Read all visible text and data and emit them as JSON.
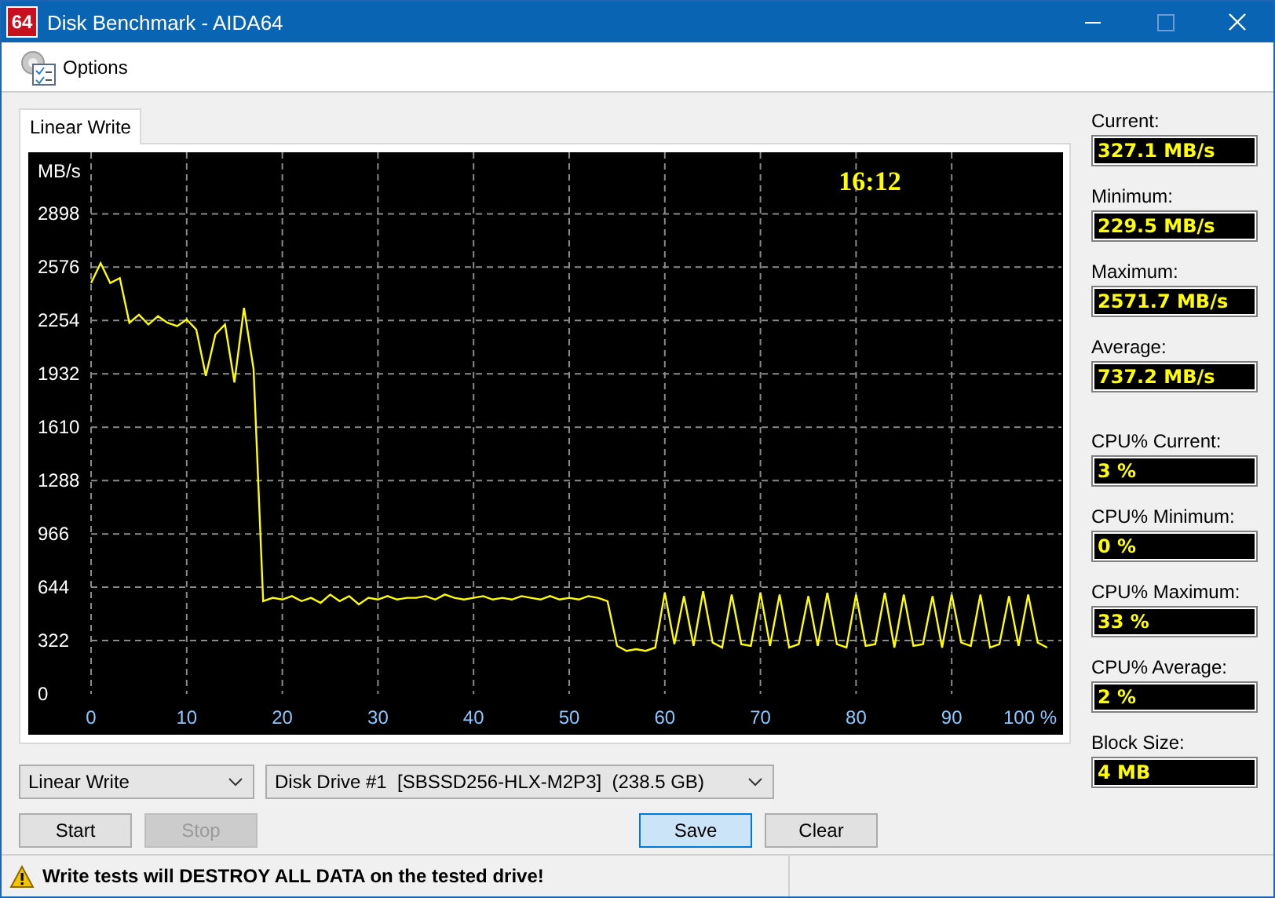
{
  "window": {
    "icon_label": "64",
    "title": "Disk Benchmark - AIDA64"
  },
  "menu": [
    {
      "label": "Options"
    }
  ],
  "tabs": [
    {
      "label": "Linear Write",
      "selected": true
    }
  ],
  "chart": {
    "time": "16:12",
    "chart_data": {
      "type": "line",
      "grid": true,
      "ylabel": "MB/s",
      "xlim": [
        0,
        100
      ],
      "ylim": [
        0,
        3260
      ],
      "xticks": [
        0,
        10,
        20,
        30,
        40,
        50,
        60,
        70,
        80,
        90,
        {
          "value": 100,
          "label": "100 %"
        }
      ],
      "yticks": [
        0,
        322,
        644,
        966,
        1288,
        1610,
        1932,
        2254,
        2576,
        2898
      ],
      "x": [
        0,
        1,
        2,
        3,
        4,
        5,
        6,
        7,
        8,
        9,
        10,
        11,
        12,
        13,
        14,
        15,
        16,
        17,
        18,
        19,
        20,
        21,
        22,
        23,
        24,
        25,
        26,
        27,
        28,
        29,
        30,
        31,
        32,
        33,
        34,
        35,
        36,
        37,
        38,
        39,
        40,
        41,
        42,
        43,
        44,
        45,
        46,
        47,
        48,
        49,
        50,
        51,
        52,
        53,
        54,
        55,
        56,
        57,
        58,
        59,
        60,
        61,
        62,
        63,
        64,
        65,
        66,
        67,
        68,
        69,
        70,
        71,
        72,
        73,
        74,
        75,
        76,
        77,
        78,
        79,
        80,
        81,
        82,
        83,
        84,
        85,
        86,
        87,
        88,
        89,
        90,
        91,
        92,
        93,
        94,
        95,
        96,
        97,
        98,
        99,
        100
      ],
      "series": [
        {
          "color": "#ffff00",
          "values": [
            2480,
            2600,
            2480,
            2510,
            2240,
            2290,
            2230,
            2280,
            2240,
            2220,
            2260,
            2200,
            1920,
            2170,
            2230,
            1880,
            2330,
            1960,
            560,
            580,
            570,
            590,
            560,
            580,
            550,
            600,
            560,
            590,
            540,
            580,
            570,
            590,
            570,
            580,
            580,
            590,
            570,
            600,
            580,
            570,
            580,
            590,
            570,
            580,
            570,
            590,
            580,
            570,
            590,
            570,
            580,
            570,
            590,
            580,
            560,
            290,
            260,
            270,
            260,
            280,
            610,
            300,
            590,
            290,
            620,
            310,
            280,
            600,
            300,
            290,
            610,
            290,
            600,
            280,
            300,
            590,
            290,
            610,
            300,
            280,
            600,
            290,
            300,
            610,
            280,
            600,
            290,
            300,
            590,
            280,
            600,
            310,
            290,
            600,
            280,
            300,
            590,
            290,
            600,
            310,
            280
          ]
        }
      ]
    }
  },
  "stat_groups": [
    [
      {
        "label": "Current:",
        "value": "327.1 MB/s"
      },
      {
        "label": "Minimum:",
        "value": "229.5 MB/s"
      },
      {
        "label": "Maximum:",
        "value": "2571.7 MB/s"
      },
      {
        "label": "Average:",
        "value": "737.2 MB/s"
      }
    ],
    [
      {
        "label": "CPU% Current:",
        "value": "3 %"
      },
      {
        "label": "CPU% Minimum:",
        "value": "0 %"
      },
      {
        "label": "CPU% Maximum:",
        "value": "33 %"
      },
      {
        "label": "CPU% Average:",
        "value": "2 %"
      },
      {
        "label": "Block Size:",
        "value": "4 MB"
      }
    ]
  ],
  "test_select": {
    "value": "Linear Write"
  },
  "drive_select": {
    "value": "Disk Drive #1  [SBSSD256-HLX-M2P3]  (238.5 GB)"
  },
  "buttons": [
    {
      "label": "Start",
      "disabled": false,
      "default": false
    },
    {
      "label": "Stop",
      "disabled": true,
      "default": false
    },
    {
      "label": "Save",
      "disabled": false,
      "default": true
    },
    {
      "label": "Clear",
      "disabled": false,
      "default": false
    }
  ],
  "status": {
    "text": "Write tests will DESTROY ALL DATA on the tested drive!"
  }
}
